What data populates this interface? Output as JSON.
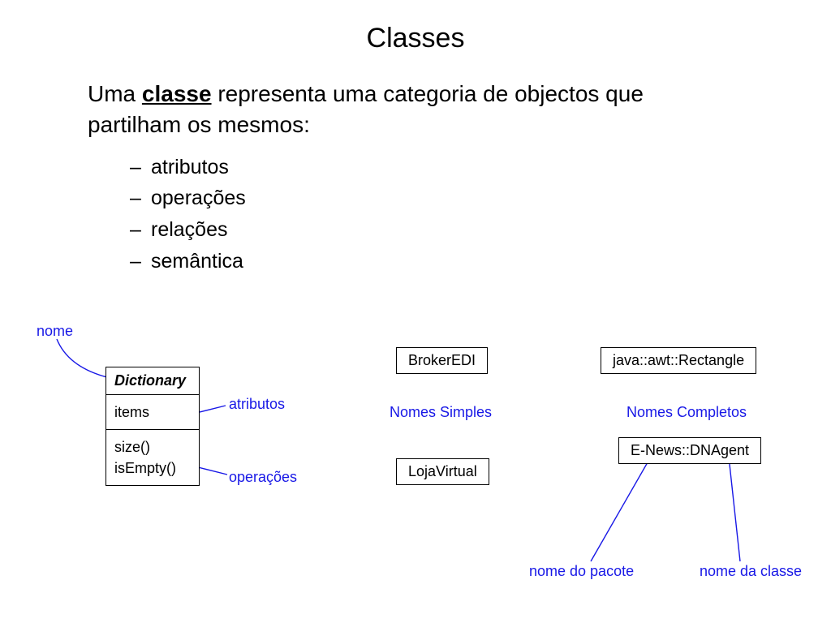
{
  "title": "Classes",
  "lead": {
    "pre": "Uma ",
    "keyword": "classe",
    "post": " representa uma categoria de objectos que partilham os mesmos:"
  },
  "bullets": [
    "atributos",
    "operações",
    "relações",
    "semântica"
  ],
  "annotations": {
    "nome": "nome",
    "atributos": "atributos",
    "operacoes": "operações",
    "nomes_simples": "Nomes Simples",
    "nomes_completos": "Nomes Completos",
    "nome_pacote": "nome do pacote",
    "nome_classe": "nome da classe"
  },
  "uml_class": {
    "name": "Dictionary",
    "attributes": [
      "items"
    ],
    "operations": [
      "size()",
      "isEmpty()"
    ]
  },
  "simple_boxes": {
    "broker": "BrokerEDI",
    "loja": "LojaVirtual",
    "rectangle": "java::awt::Rectangle",
    "dnagent": "E-News::DNAgent"
  }
}
